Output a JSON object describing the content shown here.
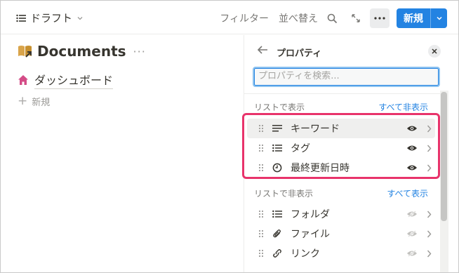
{
  "topbar": {
    "view_label": "ドラフト",
    "filter_label": "フィルター",
    "sort_label": "並べ替え",
    "new_label": "新規"
  },
  "page": {
    "title": "Documents",
    "title_more": "···",
    "linked_page": "ダッシュボード",
    "new_label": "新規"
  },
  "panel": {
    "title": "プロパティ",
    "search_placeholder": "プロパティを検索...",
    "shown_section": {
      "label": "リストで表示",
      "action": "すべて非表示",
      "items": [
        {
          "name": "キーワード",
          "icon": "text-lines-icon",
          "visible": true
        },
        {
          "name": "タグ",
          "icon": "list-icon",
          "visible": true
        },
        {
          "name": "最終更新日時",
          "icon": "clock-icon",
          "visible": true
        }
      ]
    },
    "hidden_section": {
      "label": "リストで非表示",
      "action": "すべて表示",
      "items": [
        {
          "name": "フォルダ",
          "icon": "list-icon",
          "visible": false
        },
        {
          "name": "ファイル",
          "icon": "paperclip-icon",
          "visible": false
        },
        {
          "name": "リンク",
          "icon": "link-icon",
          "visible": false
        }
      ]
    }
  },
  "colors": {
    "accent": "#2383e2",
    "highlight": "#e8336b",
    "home_icon": "#d44c87"
  }
}
